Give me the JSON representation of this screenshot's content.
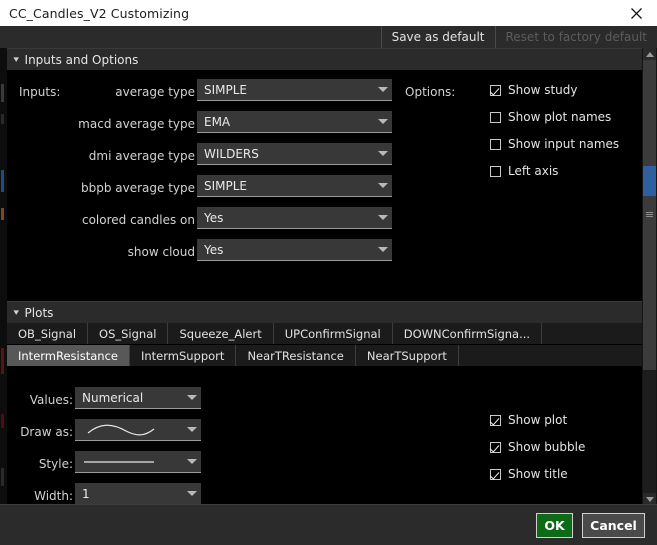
{
  "window": {
    "title": "CC_Candles_V2 Customizing",
    "close_icon": "close-icon"
  },
  "toolbar": {
    "save_as_default": "Save as default",
    "reset_to_factory_default": "Reset to factory default"
  },
  "sections": {
    "inputs_and_options": "Inputs and Options",
    "plots": "Plots"
  },
  "inputs": {
    "group_label": "Inputs:",
    "rows": [
      {
        "label": "average type",
        "value": "SIMPLE"
      },
      {
        "label": "macd average type",
        "value": "EMA"
      },
      {
        "label": "dmi average type",
        "value": "WILDERS"
      },
      {
        "label": "bbpb average type",
        "value": "SIMPLE"
      },
      {
        "label": "colored candles on",
        "value": "Yes"
      },
      {
        "label": "show cloud",
        "value": "Yes"
      }
    ]
  },
  "options": {
    "group_label": "Options:",
    "items": [
      {
        "label": "Show study",
        "checked": true
      },
      {
        "label": "Show plot names",
        "checked": false
      },
      {
        "label": "Show input names",
        "checked": false
      },
      {
        "label": "Left axis",
        "checked": false
      }
    ]
  },
  "plot_tabs": {
    "row1": [
      {
        "label": "OB_Signal",
        "active": false
      },
      {
        "label": "OS_Signal",
        "active": false
      },
      {
        "label": "Squeeze_Alert",
        "active": false
      },
      {
        "label": "UPConfirmSignal",
        "active": false
      },
      {
        "label": "DOWNConfirmSigna...",
        "active": false
      }
    ],
    "row2": [
      {
        "label": "IntermResistance",
        "active": true
      },
      {
        "label": "IntermSupport",
        "active": false
      },
      {
        "label": "NearTResistance",
        "active": false
      },
      {
        "label": "NearTSupport",
        "active": false
      }
    ]
  },
  "plot_form": {
    "values_label": "Values:",
    "values_value": "Numerical",
    "draw_as_label": "Draw as:",
    "draw_as_value": "line-curve-icon",
    "style_label": "Style:",
    "style_value": "solid-line-icon",
    "width_label": "Width:",
    "width_value": "1",
    "checkboxes": [
      {
        "label": "Show plot",
        "checked": true
      },
      {
        "label": "Show bubble",
        "checked": true
      },
      {
        "label": "Show title",
        "checked": true
      }
    ]
  },
  "footer": {
    "ok": "OK",
    "cancel": "Cancel"
  },
  "colors": {
    "title_bar": "#ffffff",
    "toolbar": "#2b2b2b",
    "panel": "#000000",
    "dropdown": "#383838",
    "tab_active": "#585858",
    "ok_button": "#0d6b17",
    "cancel_button": "#4a4a4a",
    "scrollbar_highlight": "#2e5f9e"
  }
}
